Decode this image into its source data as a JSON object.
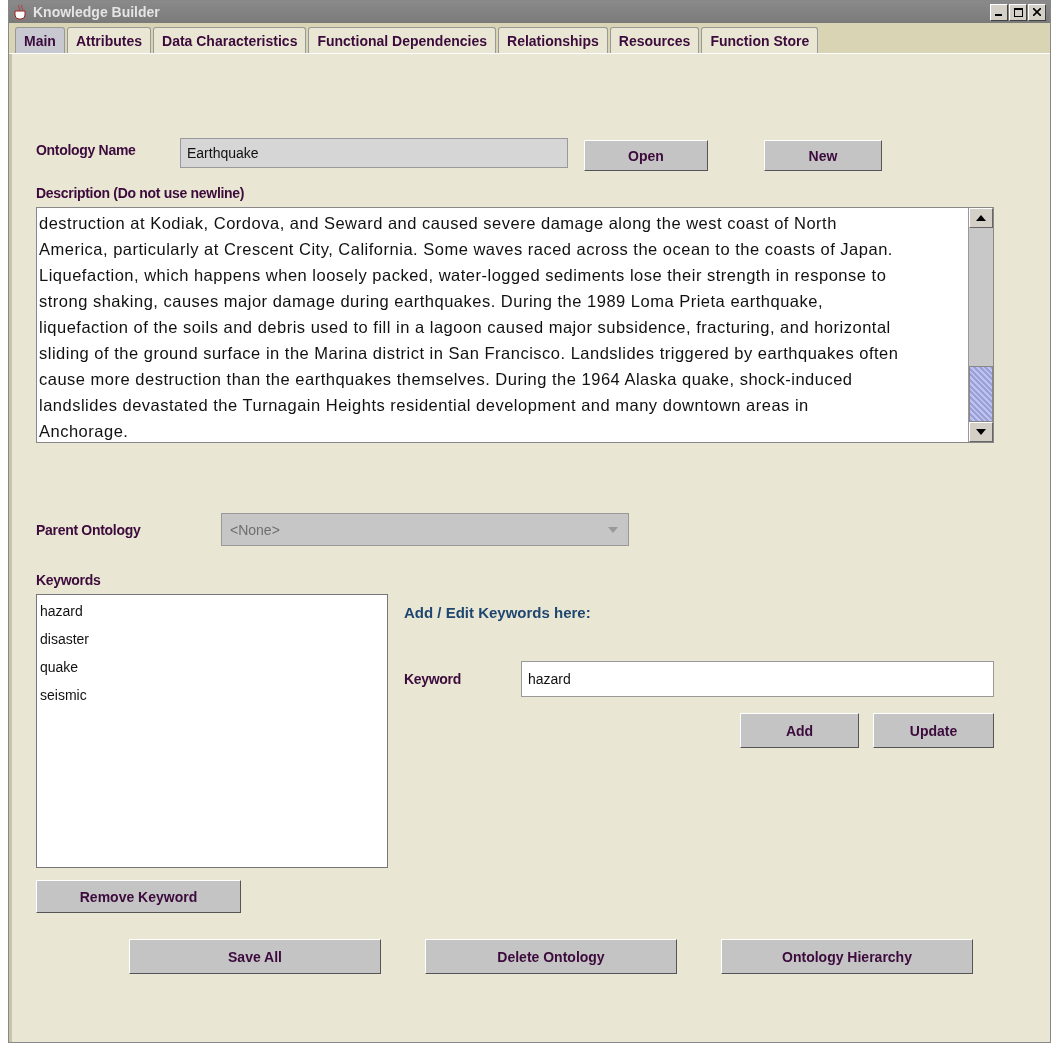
{
  "window": {
    "title": "Knowledge Builder"
  },
  "tabs": [
    {
      "label": "Main",
      "selected": true
    },
    {
      "label": "Attributes",
      "selected": false
    },
    {
      "label": "Data Characteristics",
      "selected": false
    },
    {
      "label": "Functional Dependencies",
      "selected": false
    },
    {
      "label": "Relationships",
      "selected": false
    },
    {
      "label": "Resources",
      "selected": false
    },
    {
      "label": "Function Store",
      "selected": false
    }
  ],
  "ontology_name": {
    "label": "Ontology Name",
    "value": "Earthquake",
    "buttons": [
      "Open",
      "New"
    ]
  },
  "description": {
    "label": "Description (Do not use newline)",
    "lines": [
      "destruction at Kodiak, Cordova, and Seward and caused severe damage along the west coast of North",
      "America, particularly at Crescent City, California. Some waves raced across the ocean to the coasts of Japan.",
      "Liquefaction, which happens when loosely packed, water-logged sediments lose their strength in response to",
      "strong shaking, causes major damage during earthquakes. During the 1989 Loma Prieta earthquake,",
      "liquefaction of the soils and debris used to fill in a lagoon caused major subsidence, fracturing, and horizontal",
      "sliding of the ground surface in the Marina district in San Francisco. Landslides triggered by earthquakes often",
      "cause more destruction than the earthquakes themselves. During the 1964 Alaska quake, shock-induced",
      "landslides devastated the Turnagain Heights residential development and many downtown areas in",
      "Anchorage."
    ]
  },
  "parent_ontology": {
    "label": "Parent Ontology",
    "value": "<None>",
    "disabled": true
  },
  "keywords": {
    "label": "Keywords",
    "items": [
      "hazard",
      "disaster",
      "quake",
      "seismic"
    ],
    "remove_button": "Remove Keyword"
  },
  "keyword_editor": {
    "heading": "Add / Edit Keywords here:",
    "label": "Keyword",
    "value": "hazard",
    "buttons": [
      "Add",
      "Update"
    ]
  },
  "footer_buttons": [
    "Save All",
    "Delete Ontology",
    "Ontology Hierarchy"
  ]
}
